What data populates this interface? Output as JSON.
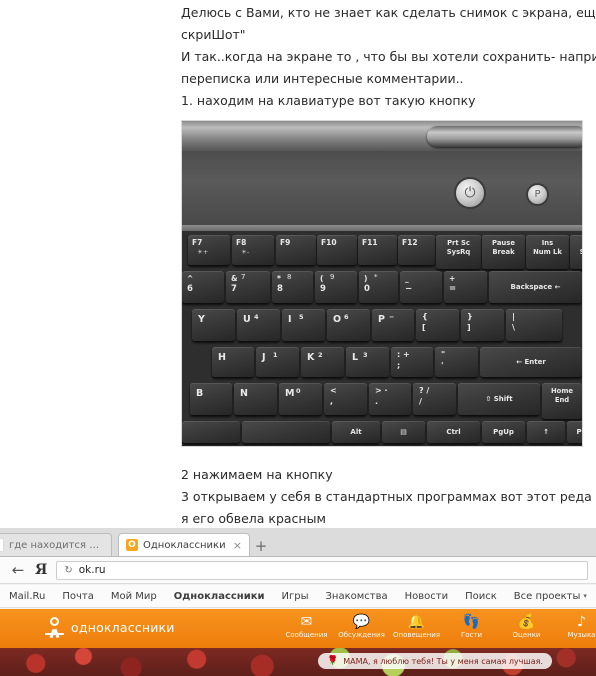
{
  "post": {
    "lines": [
      "Делюсь с Вами, кто не знает как сделать снимок с экрана, ещё",
      "скриШот\"",
      "И так..когда на экране то , что бы вы хотели сохранить- напри",
      "переписка или интересные комментарии..",
      "1. находим на клавиатуре вот такую кнопку"
    ],
    "captions": [
      "2 нажимаем на кнопку",
      "3 открываем у себя в стандартных программах  вот этот реда",
      "я его обвела красным"
    ]
  },
  "keyboard_photo": {
    "power_button_icon": "⏻",
    "p_button_label": "P",
    "highlight": "red-circle-around-prt-sc-key",
    "rows": [
      {
        "name": "function-row",
        "keys": [
          {
            "type": "fn",
            "label": "F7",
            "sub": "☀+"
          },
          {
            "type": "fn",
            "label": "F8",
            "sub": "☀-"
          },
          {
            "type": "fn",
            "label": "F9",
            "sub": ""
          },
          {
            "type": "fn",
            "label": "F10",
            "sub": ""
          },
          {
            "type": "fn",
            "label": "F11",
            "sub": ""
          },
          {
            "type": "fn",
            "label": "F12",
            "sub": ""
          },
          {
            "type": "stack",
            "top": "Prt Sc",
            "bottom": "SysRq"
          },
          {
            "type": "stack",
            "top": "Pause",
            "bottom": "Break"
          },
          {
            "type": "stack",
            "top": "Ins",
            "bottom": "Num Lk"
          },
          {
            "type": "stack",
            "top": "Del",
            "bottom": "Scr Lk"
          }
        ]
      },
      {
        "name": "number-row",
        "keys": [
          {
            "type": "two",
            "up": "^",
            "lo": "6"
          },
          {
            "type": "two",
            "up": "&",
            "upr": "7",
            "lo": "7"
          },
          {
            "type": "two",
            "up": "*",
            "upr": "8",
            "lo": "8"
          },
          {
            "type": "two",
            "up": "(",
            "upr": "9",
            "lo": "9"
          },
          {
            "type": "two",
            "up": ")",
            "upr": "*",
            "lo": "0"
          },
          {
            "type": "two",
            "up": "_",
            "lo": "−"
          },
          {
            "type": "two",
            "up": "+",
            "lo": "="
          },
          {
            "type": "wide",
            "label": "Backspace ←"
          }
        ]
      },
      {
        "name": "top-letter-row",
        "keys": [
          {
            "type": "alpha",
            "label": "Y",
            "num": ""
          },
          {
            "type": "alpha",
            "label": "U",
            "num": "4"
          },
          {
            "type": "alpha",
            "label": "I",
            "num": "5"
          },
          {
            "type": "alpha",
            "label": "O",
            "num": "6"
          },
          {
            "type": "alpha",
            "label": "P",
            "num": "−"
          },
          {
            "type": "sym",
            "up": "{",
            "lo": "["
          },
          {
            "type": "sym",
            "up": "}",
            "lo": "]"
          },
          {
            "type": "sym",
            "up": "|",
            "lo": "\\"
          }
        ]
      },
      {
        "name": "home-row",
        "keys": [
          {
            "type": "alpha",
            "label": "H",
            "num": ""
          },
          {
            "type": "alpha",
            "label": "J",
            "num": "1"
          },
          {
            "type": "alpha",
            "label": "K",
            "num": "2"
          },
          {
            "type": "alpha",
            "label": "L",
            "num": "3"
          },
          {
            "type": "sym",
            "up": ":  +",
            "lo": ";"
          },
          {
            "type": "sym",
            "up": "\"",
            "lo": "'"
          },
          {
            "type": "wide",
            "label": "← Enter"
          }
        ]
      },
      {
        "name": "bottom-letter-row",
        "keys": [
          {
            "type": "alpha",
            "label": "B",
            "num": ""
          },
          {
            "type": "alpha",
            "label": "N",
            "num": ""
          },
          {
            "type": "alpha",
            "label": "M",
            "num": "0"
          },
          {
            "type": "sym",
            "up": "<",
            "lo": ","
          },
          {
            "type": "sym",
            "up": ">  ·",
            "lo": "."
          },
          {
            "type": "sym",
            "up": "?  /",
            "lo": "/"
          },
          {
            "type": "wide",
            "label": "⇧ Shift"
          },
          {
            "type": "stack",
            "top": "Home",
            "bottom": "End"
          }
        ]
      },
      {
        "name": "modifier-row",
        "keys": [
          {
            "type": "blank",
            "label": ""
          },
          {
            "type": "blank",
            "label": ""
          },
          {
            "type": "wide",
            "label": "Alt"
          },
          {
            "type": "wide",
            "label": "▤"
          },
          {
            "type": "wide",
            "label": "Ctrl"
          },
          {
            "type": "wide",
            "label": "PgUp"
          },
          {
            "type": "wide",
            "label": "↑"
          },
          {
            "type": "wide",
            "label": "PgDn"
          }
        ]
      }
    ]
  },
  "browser": {
    "tabs": [
      {
        "favicon": "Я",
        "title": "где находится кнопк..",
        "active": false,
        "close_label": ""
      },
      {
        "favicon": "О",
        "title": "Одноклассники",
        "active": true,
        "close_label": "×"
      }
    ],
    "new_tab_label": "+",
    "back_label": "←",
    "yandex_logo": "Я",
    "reload_icon": "↻",
    "url": "ok.ru",
    "bookmarks": [
      {
        "label": "Mail.Ru",
        "current": false,
        "caret": ""
      },
      {
        "label": "Почта",
        "current": false,
        "caret": ""
      },
      {
        "label": "Мой Мир",
        "current": false,
        "caret": ""
      },
      {
        "label": "Одноклассники",
        "current": true,
        "caret": ""
      },
      {
        "label": "Игры",
        "current": false,
        "caret": ""
      },
      {
        "label": "Знакомства",
        "current": false,
        "caret": ""
      },
      {
        "label": "Новости",
        "current": false,
        "caret": ""
      },
      {
        "label": "Поиск",
        "current": false,
        "caret": ""
      },
      {
        "label": "Все проекты",
        "current": false,
        "caret": "▾"
      }
    ]
  },
  "ok_site": {
    "brand": "одноклассники",
    "brand_color": "#f7931e",
    "nav": [
      {
        "label": "Сообщения",
        "icon": "✉"
      },
      {
        "label": "Обсуждения",
        "icon": "💬"
      },
      {
        "label": "Оповещения",
        "icon": "🔔"
      },
      {
        "label": "Гости",
        "icon": "👣"
      },
      {
        "label": "Оценки",
        "icon": "💰"
      },
      {
        "label": "Музыка",
        "icon": "♪"
      }
    ],
    "video_button_icon": "▶",
    "banner_text": "МАМА, я люблю тебя! Ты у меня самая лучшая.",
    "banner_icon": "🌹"
  }
}
